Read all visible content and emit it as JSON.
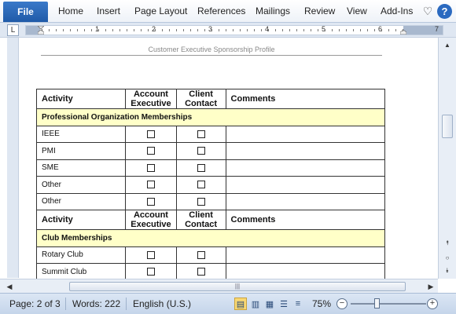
{
  "ribbon": {
    "file_label": "File",
    "tabs": [
      "Home",
      "Insert",
      "Page Layout",
      "References",
      "Mailings",
      "Review",
      "View",
      "Add-Ins"
    ],
    "heart_icon": "♡",
    "help_icon": "?"
  },
  "ruler": {
    "numbers": [
      "1",
      "2",
      "3",
      "4",
      "5",
      "6",
      "7"
    ],
    "tab_selector": "L"
  },
  "document": {
    "header_text": "Customer Executive Sponsorship Profile",
    "table": {
      "headers": [
        "Activity",
        "Account Executive",
        "Client Contact",
        "Comments"
      ],
      "sections": [
        {
          "title": "Professional Organization Memberships",
          "rows": [
            "IEEE",
            "PMI",
            "SME",
            "Other",
            "Other"
          ]
        },
        {
          "title": "Club Memberships",
          "rows": [
            "Rotary Club",
            "Summit Club"
          ]
        }
      ]
    }
  },
  "scrollbar": {
    "thumb_grip": "|||"
  },
  "status_bar": {
    "page": "Page: 2 of 3",
    "words": "Words: 222",
    "language": "English (U.S.)",
    "zoom": "75%",
    "zoom_out": "−",
    "zoom_in": "+"
  },
  "colors": {
    "section_fill": "#ffffc8",
    "file_tab": "#2b6ac0",
    "status_bar": "#c5d5ea"
  }
}
